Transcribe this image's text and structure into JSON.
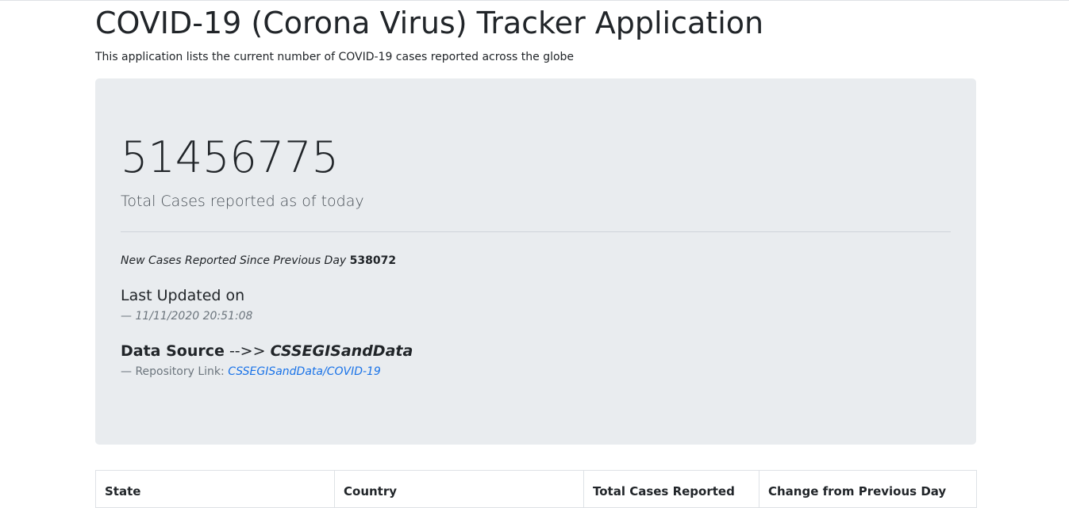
{
  "header": {
    "title": "COVID-19 (Corona Virus) Tracker Application",
    "subtitle": "This application lists the current number of COVID-19 cases reported across the globe"
  },
  "summary": {
    "total_cases": "51456775",
    "total_cases_label": "Total Cases reported as of today",
    "new_cases_label": "New Cases Reported Since Previous Day",
    "new_cases_value": "538072",
    "last_updated_label": "Last Updated on",
    "last_updated_value": "— 11/11/2020 20:51:08",
    "data_source_label": "Data Source",
    "data_source_arrow": "-->>",
    "data_source_name": "CSSEGISandData",
    "repo_prefix": "— Repository Link:",
    "repo_link_text": "CSSEGISandData/COVID-19"
  },
  "table": {
    "columns": [
      "State",
      "Country",
      "Total Cases Reported",
      "Change from Previous Day"
    ]
  },
  "colors": {
    "jumbotron_bg": "#e9ecef",
    "link": "#1a73e8",
    "muted": "#6c757d"
  }
}
